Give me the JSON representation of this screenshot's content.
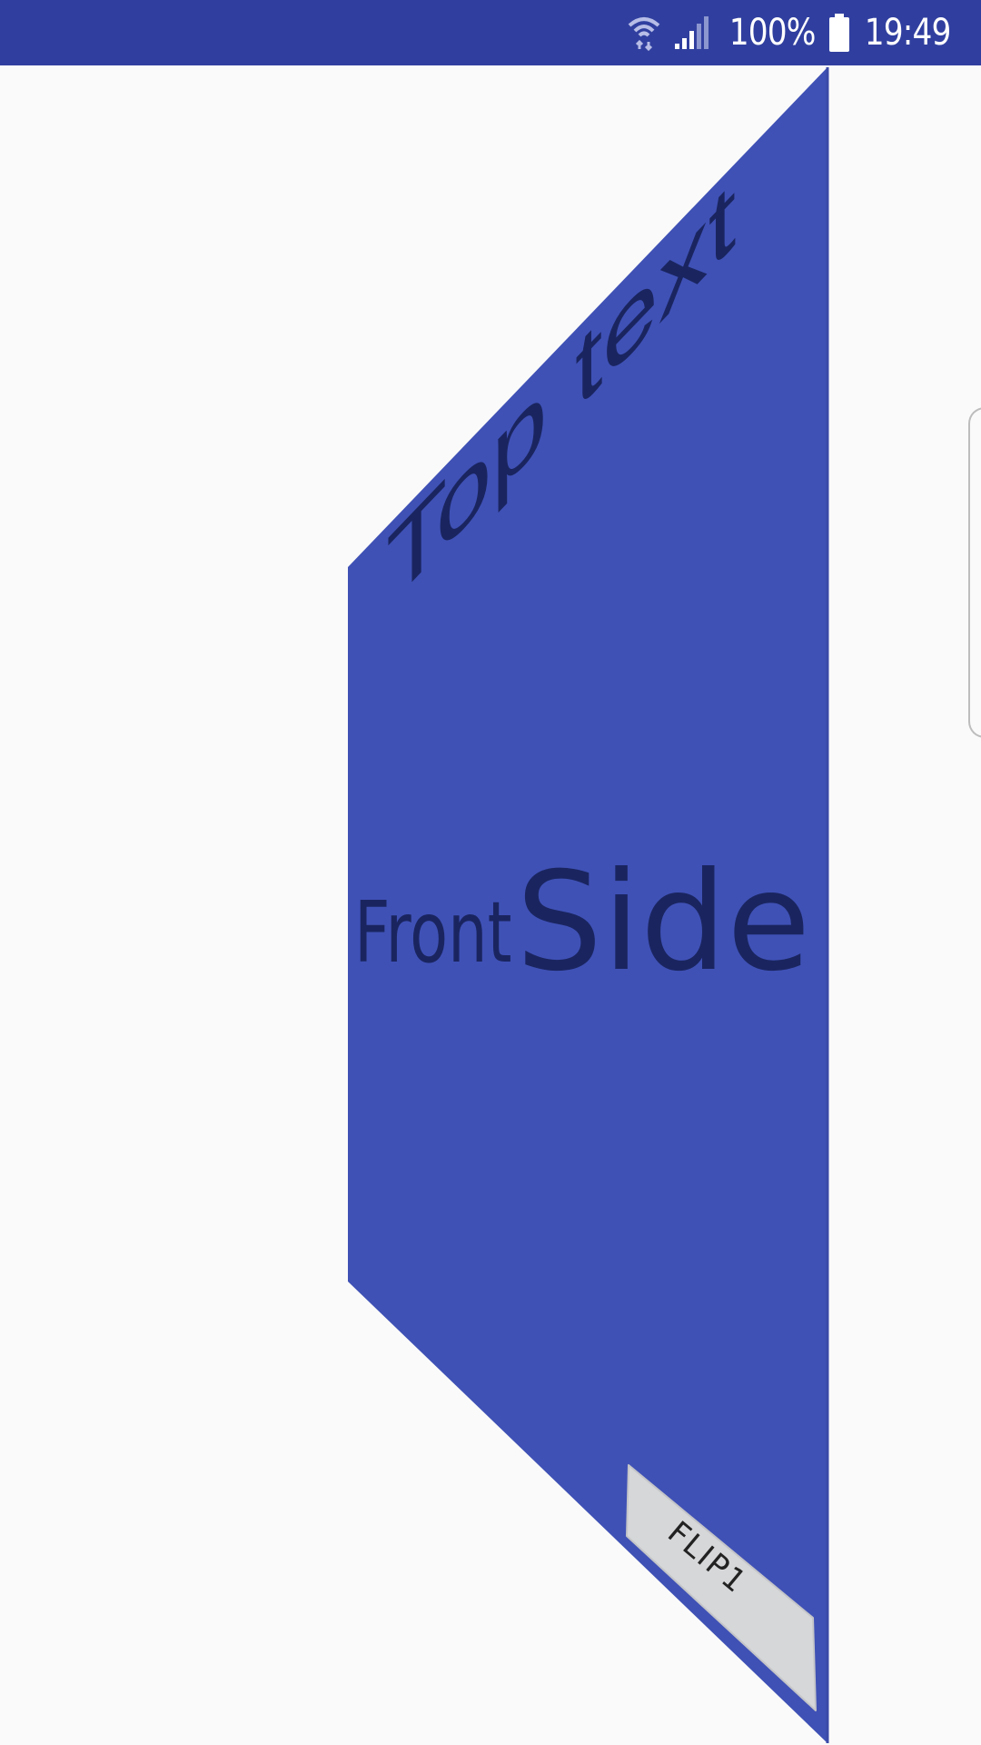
{
  "status_bar": {
    "battery_percent_text": "100%",
    "time": "19:49",
    "background_color": "#303f9f",
    "icons": [
      "wifi-icon",
      "signal-icon",
      "battery-icon"
    ]
  },
  "card": {
    "top_text": "Top text",
    "front_text_a": "Front",
    "front_text_b": "Side",
    "color": "#3f51b5",
    "text_color": "#1a2560"
  },
  "flip_button": {
    "label": "FLIP1",
    "color": "#d6d7d9"
  }
}
